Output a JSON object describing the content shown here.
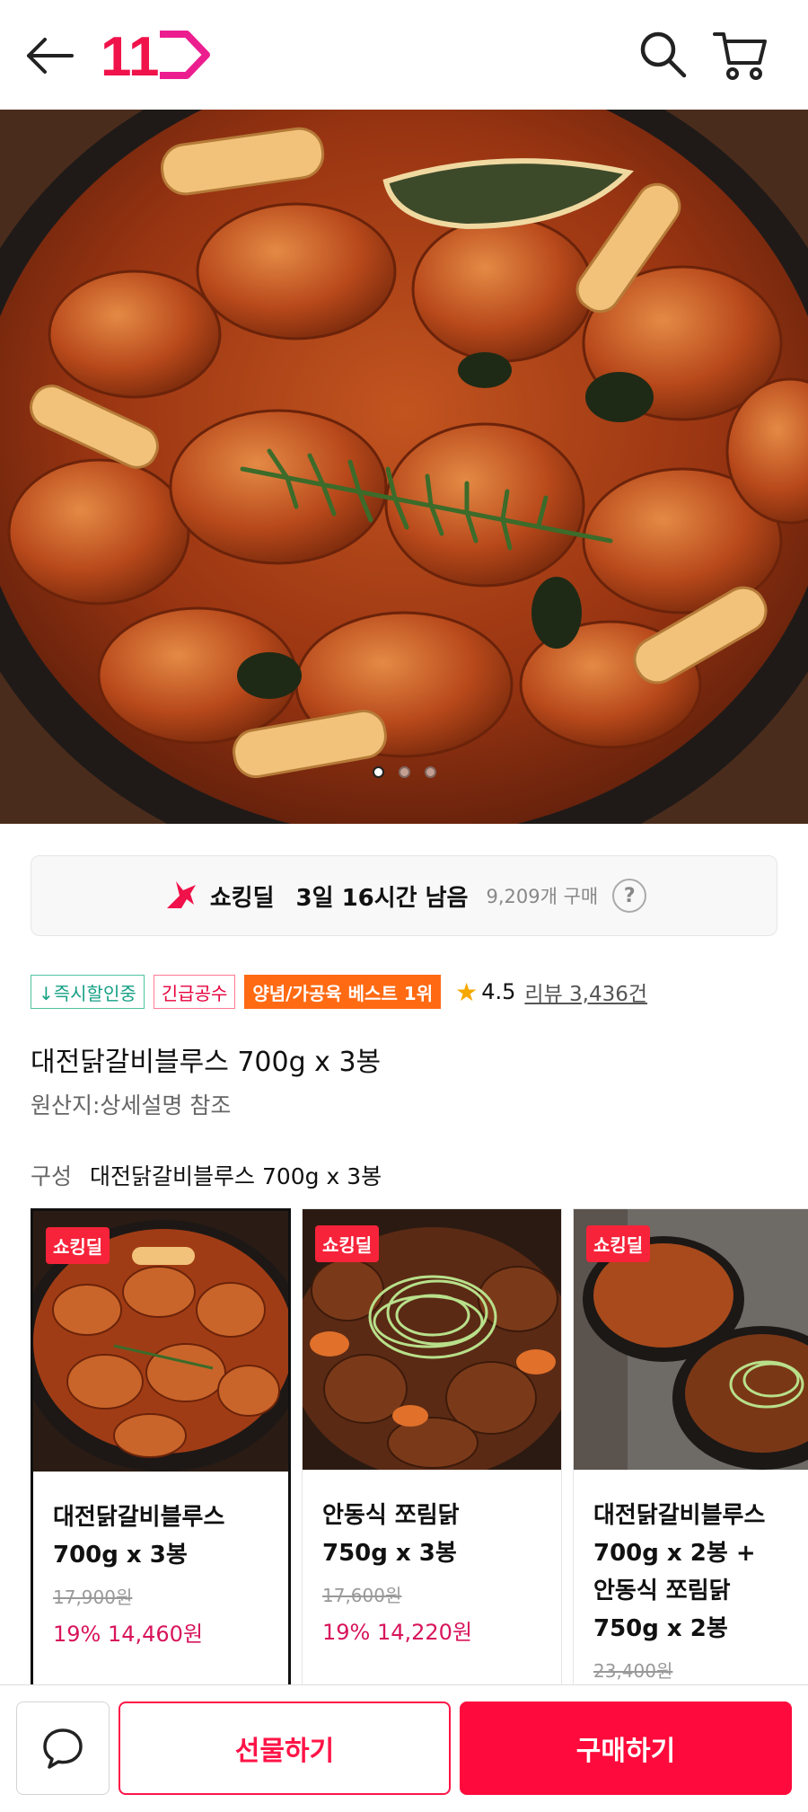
{
  "header": {
    "logo_text": "11",
    "icons": [
      "back-arrow-icon",
      "search-icon",
      "cart-icon"
    ]
  },
  "hero": {
    "image": "spicy-braised-chicken-photo",
    "carousel": {
      "total": 3,
      "current": 1
    }
  },
  "deal": {
    "title": "쇼킹딜",
    "time_left": "3일 16시간 남음",
    "purchase_count": "9,209개 구매",
    "help_label": "?"
  },
  "badges": {
    "instant_discount": "↓즉시할인중",
    "urgent": "긴급공수",
    "best": "양념/가공육 베스트 1위"
  },
  "rating": {
    "score": "4.5",
    "review_label": "리뷰 3,436건"
  },
  "product": {
    "title": "대전닭갈비블루스 700g x 3봉",
    "origin": "원산지:상세설명 참조"
  },
  "composition": {
    "label": "구성",
    "value": "대전닭갈비블루스 700g x 3봉"
  },
  "cards": [
    {
      "badge": "쇼킹딜",
      "name_line1": "대전닭갈비블루스",
      "name_line2": "700g x 3봉",
      "original_price": "17,900원",
      "sale": "19% 14,460원",
      "selected": true
    },
    {
      "badge": "쇼킹딜",
      "name_line1": "안동식 쪼림닭",
      "name_line2": "750g x 3봉",
      "original_price": "17,600원",
      "sale": "19% 14,220원",
      "selected": false
    },
    {
      "badge": "쇼킹딜",
      "name_line1": "대전닭갈비블루스",
      "name_line2": "700g x 2봉 +",
      "name_line3": "안동식 쪼림닭",
      "name_line4": "750g x 2봉",
      "original_price": "23,400원",
      "selected": false
    }
  ],
  "bottom": {
    "gift_label": "선물하기",
    "buy_label": "구매하기"
  },
  "colors": {
    "brand_red": "#ff0a3c",
    "sale_pink": "#d8145b",
    "badge_orange": "#ff6a13",
    "badge_green": "#16a085"
  }
}
